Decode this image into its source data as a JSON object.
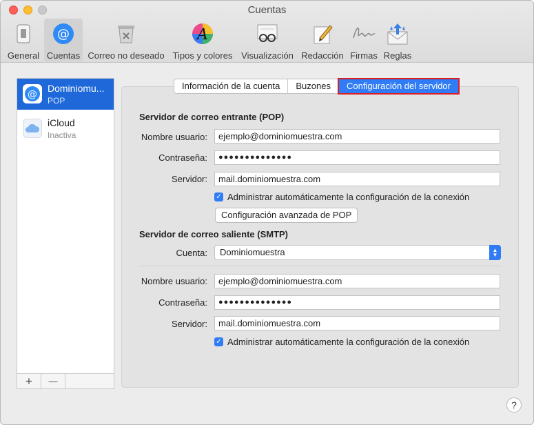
{
  "window": {
    "title": "Cuentas"
  },
  "toolbar": {
    "items": [
      {
        "label": "General",
        "icon": "general-switch-icon"
      },
      {
        "label": "Cuentas",
        "icon": "at-icon",
        "selected": true
      },
      {
        "label": "Correo no deseado",
        "icon": "junk-trash-icon"
      },
      {
        "label": "Tipos y colores",
        "icon": "fonts-colors-icon"
      },
      {
        "label": "Visualización",
        "icon": "glasses-icon"
      },
      {
        "label": "Redacción",
        "icon": "pencil-paper-icon"
      },
      {
        "label": "Firmas",
        "icon": "signature-icon"
      },
      {
        "label": "Reglas",
        "icon": "rules-envelope-icon"
      }
    ]
  },
  "sidebar": {
    "accounts": [
      {
        "name": "Dominiomu...",
        "sub": "POP",
        "selected": true
      },
      {
        "name": "iCloud",
        "sub": "Inactiva",
        "selected": false
      }
    ],
    "add_label": "+",
    "remove_label": "—"
  },
  "tabs": [
    {
      "label": "Información de la cuenta"
    },
    {
      "label": "Buzones"
    },
    {
      "label": "Configuración del servidor",
      "active": true
    }
  ],
  "incoming": {
    "heading": "Servidor de correo entrante (POP)",
    "username_label": "Nombre usuario:",
    "username": "ejemplo@dominiomuestra.com",
    "password_label": "Contraseña:",
    "password": "●●●●●●●●●●●●●●",
    "server_label": "Servidor:",
    "server": "mail.dominiomuestra.com",
    "auto_manage": "Administrar automáticamente la configuración de la conexión",
    "advanced_button": "Configuración avanzada de POP"
  },
  "outgoing": {
    "heading": "Servidor de correo saliente (SMTP)",
    "account_label": "Cuenta:",
    "account": "Dominiomuestra",
    "username_label": "Nombre usuario:",
    "username": "ejemplo@dominiomuestra.com",
    "password_label": "Contraseña:",
    "password": "●●●●●●●●●●●●●●",
    "server_label": "Servidor:",
    "server": "mail.dominiomuestra.com",
    "auto_manage": "Administrar automáticamente la configuración de la conexión"
  },
  "help": {
    "label": "?"
  },
  "colors": {
    "accent": "#2f7cf6",
    "selection": "#1e68d9",
    "highlight_border": "#d81f26"
  }
}
